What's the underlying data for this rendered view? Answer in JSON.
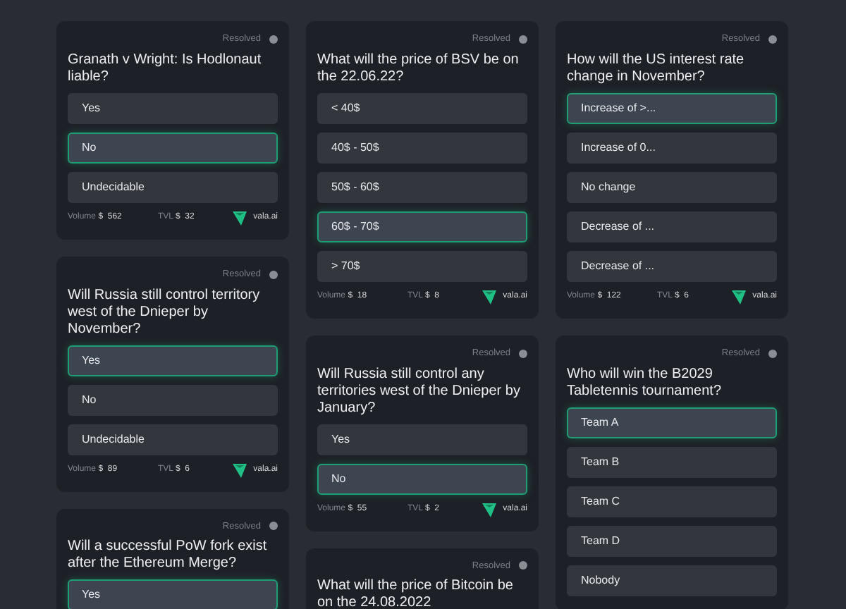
{
  "columns": [
    {
      "cards": [
        {
          "status": "Resolved",
          "question": "Granath v Wright: Is Hodlonaut liable?",
          "options": [
            {
              "label": "Yes",
              "selected": false
            },
            {
              "label": "No",
              "selected": true
            },
            {
              "label": "Undecidable",
              "selected": false
            }
          ],
          "footer": {
            "volume_label": "Volume",
            "volume_currency": "$",
            "volume": "562",
            "tvl_label": "TVL",
            "tvl_currency": "$",
            "tvl": "32",
            "brand": "vala.ai"
          }
        },
        {
          "status": "Resolved",
          "question": "Will Russia still control territory west of the Dnieper by November?",
          "options": [
            {
              "label": "Yes",
              "selected": true
            },
            {
              "label": "No",
              "selected": false
            },
            {
              "label": "Undecidable",
              "selected": false
            }
          ],
          "footer": {
            "volume_label": "Volume",
            "volume_currency": "$",
            "volume": "89",
            "tvl_label": "TVL",
            "tvl_currency": "$",
            "tvl": "6",
            "brand": "vala.ai"
          }
        },
        {
          "status": "Resolved",
          "question": "Will a successful PoW fork exist after the Ethereum Merge?",
          "options": [
            {
              "label": "Yes",
              "selected": true
            }
          ]
        }
      ]
    },
    {
      "cards": [
        {
          "status": "Resolved",
          "question": "What will the price of BSV be on the 22.06.22?",
          "options": [
            {
              "label": "< 40$",
              "selected": false
            },
            {
              "label": "40$ - 50$",
              "selected": false
            },
            {
              "label": "50$ - 60$",
              "selected": false
            },
            {
              "label": "60$ - 70$",
              "selected": true
            },
            {
              "label": "> 70$",
              "selected": false
            }
          ],
          "footer": {
            "volume_label": "Volume",
            "volume_currency": "$",
            "volume": "18",
            "tvl_label": "TVL",
            "tvl_currency": "$",
            "tvl": "8",
            "brand": "vala.ai"
          }
        },
        {
          "status": "Resolved",
          "question": "Will Russia still control any territories west of the Dnieper by January?",
          "options": [
            {
              "label": "Yes",
              "selected": false
            },
            {
              "label": "No",
              "selected": true
            }
          ],
          "footer": {
            "volume_label": "Volume",
            "volume_currency": "$",
            "volume": "55",
            "tvl_label": "TVL",
            "tvl_currency": "$",
            "tvl": "2",
            "brand": "vala.ai"
          }
        },
        {
          "status": "Resolved",
          "question": "What will the price of Bitcoin be on the 24.08.2022"
        }
      ]
    },
    {
      "cards": [
        {
          "status": "Resolved",
          "question": "How will the US interest rate change in November?",
          "options": [
            {
              "label": "Increase of >...",
              "selected": true
            },
            {
              "label": "Increase of 0...",
              "selected": false
            },
            {
              "label": "No change",
              "selected": false
            },
            {
              "label": "Decrease of ...",
              "selected": false
            },
            {
              "label": "Decrease of ...",
              "selected": false
            }
          ],
          "footer": {
            "volume_label": "Volume",
            "volume_currency": "$",
            "volume": "122",
            "tvl_label": "TVL",
            "tvl_currency": "$",
            "tvl": "6",
            "brand": "vala.ai"
          }
        },
        {
          "status": "Resolved",
          "question": "Who will win the B2029 Tabletennis tournament?",
          "options": [
            {
              "label": "Team A",
              "selected": true
            },
            {
              "label": "Team B",
              "selected": false
            },
            {
              "label": "Team C",
              "selected": false
            },
            {
              "label": "Team D",
              "selected": false
            },
            {
              "label": "Nobody",
              "selected": false
            }
          ]
        }
      ]
    }
  ]
}
